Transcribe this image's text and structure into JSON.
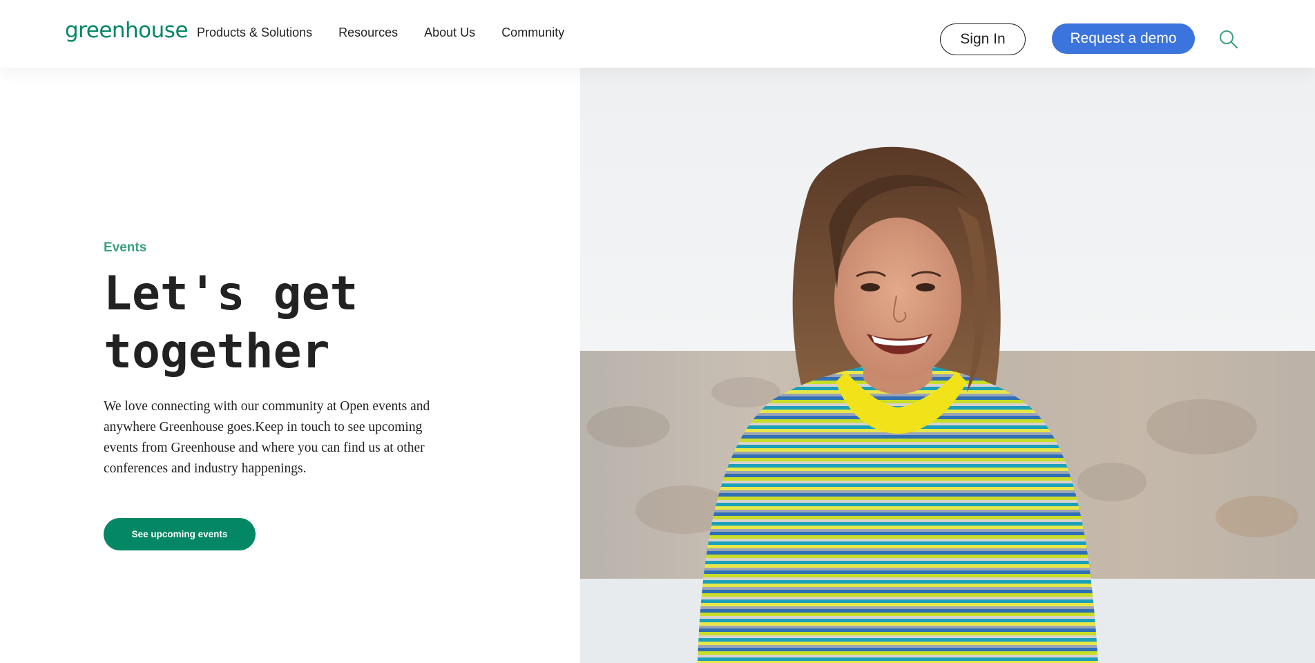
{
  "header": {
    "logo_text": "greenhouse",
    "nav": [
      {
        "label": "Products & Solutions"
      },
      {
        "label": "Resources"
      },
      {
        "label": "About Us"
      },
      {
        "label": "Community"
      }
    ],
    "signin_label": "Sign In",
    "demo_label": "Request a demo",
    "search_icon": "search-icon"
  },
  "hero": {
    "eyebrow": "Events",
    "headline": "Let's get together",
    "intro": "We love connecting with our community at Open events and anywhere Greenhouse goes.Keep in touch to see upcoming events from Greenhouse and where you can find us at other conferences and industry happenings.",
    "cta_label": "See upcoming events"
  },
  "colors": {
    "brand_green": "#038764",
    "accent_green": "#3aa17e",
    "demo_blue": "#3a74dc",
    "text": "#222222"
  }
}
